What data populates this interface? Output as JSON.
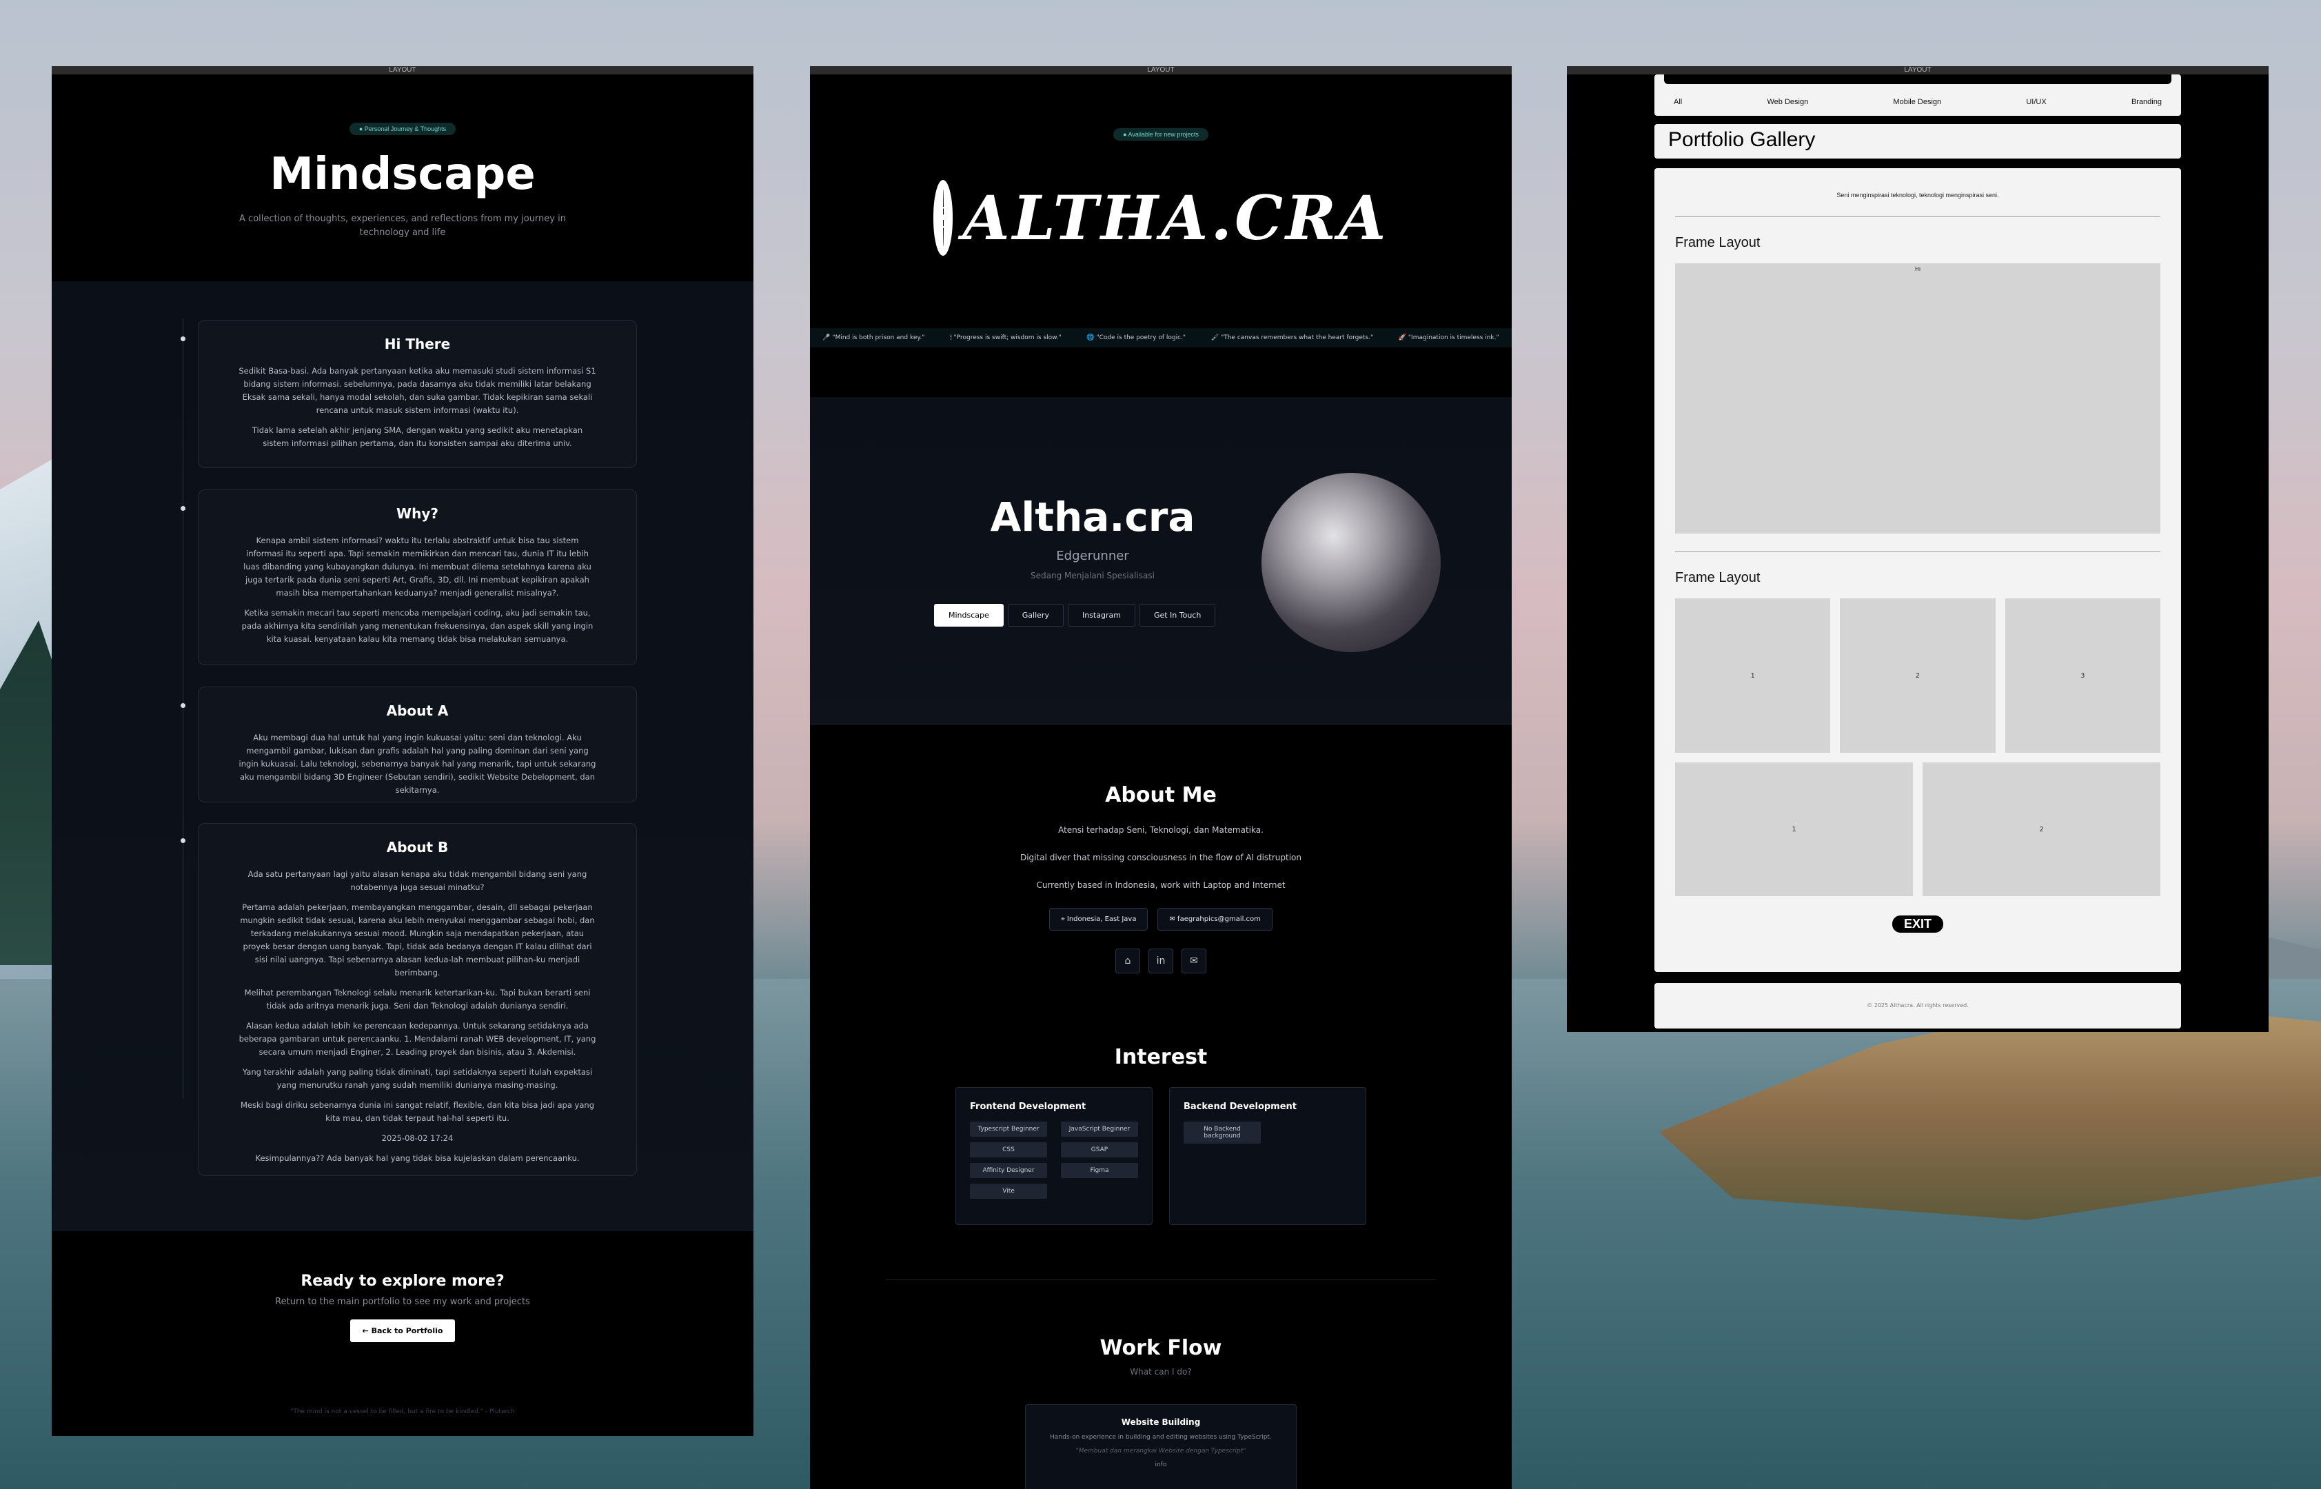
{
  "windows": {
    "titlebar": "LAYOUT"
  },
  "mindscape": {
    "badge": "● Personal Journey & Thoughts",
    "title": "Mindscape",
    "subtitle": "A collection of thoughts, experiences, and reflections from my journey in technology and life",
    "cards": [
      {
        "title": "Hi There",
        "paragraphs": [
          "Sedikit Basa-basi. Ada banyak pertanyaan ketika aku memasuki studi sistem informasi S1 bidang sistem informasi. sebelumnya, pada dasarnya aku tidak memiliki latar belakang Eksak sama sekali, hanya modal sekolah, dan suka gambar. Tidak kepikiran sama sekali rencana untuk masuk sistem informasi (waktu itu).",
          "Tidak lama setelah akhir jenjang SMA, dengan waktu yang sedikit aku menetapkan sistem informasi pilihan pertama, dan itu konsisten sampai aku diterima univ."
        ]
      },
      {
        "title": "Why?",
        "paragraphs": [
          "Kenapa ambil sistem informasi? waktu itu terlalu abstraktif untuk bisa tau sistem informasi itu seperti apa. Tapi semakin memikirkan dan mencari tau, dunia IT itu lebih luas dibanding yang kubayangkan dulunya. Ini membuat dilema setelahnya karena aku juga tertarik pada dunia seni seperti Art, Grafis, 3D, dll. Ini membuat kepikiran apakah masih bisa mempertahankan keduanya? menjadi generalist misalnya?.",
          "Ketika semakin mecari tau seperti mencoba mempelajari coding, aku jadi semakin tau, pada akhirnya kita sendirilah yang menentukan frekuensinya, dan aspek skill yang ingin kita kuasai. kenyataan kalau kita memang tidak bisa melakukan semuanya."
        ]
      },
      {
        "title": "About A",
        "paragraphs": [
          "Aku membagi dua hal untuk hal yang ingin kukuasai yaitu: seni dan teknologi. Aku mengambil gambar, lukisan dan grafis adalah hal yang paling dominan dari seni yang ingin kukuasai. Lalu teknologi, sebenarnya banyak hal yang menarik, tapi untuk sekarang aku mengambil bidang 3D Engineer (Sebutan sendiri), sedikit Website Debelopment, dan sekitarnya."
        ]
      },
      {
        "title": "About B",
        "paragraphs": [
          "Ada satu pertanyaan lagi yaitu alasan kenapa aku tidak mengambil bidang seni yang notabennya juga sesuai minatku?",
          "Pertama adalah pekerjaan, membayangkan menggambar, desain, dll sebagai pekerjaan mungkin sedikit tidak sesuai, karena aku lebih menyukai menggambar sebagai hobi, dan terkadang melakukannya sesuai mood. Mungkin saja mendapatkan pekerjaan, atau proyek besar dengan uang banyak. Tapi, tidak ada bedanya dengan IT kalau dilihat dari sisi nilai uangnya. Tapi sebenarnya alasan kedua-lah membuat pilihan-ku menjadi berimbang.",
          "Melihat perembangan Teknologi selalu menarik ketertarikan-ku. Tapi bukan berarti seni tidak ada aritnya menarik juga. Seni dan Teknologi adalah dunianya sendiri.",
          "Alasan kedua adalah lebih ke perencaan kedepannya. Untuk sekarang setidaknya ada beberapa gambaran untuk perencaanku. 1. Mendalami ranah WEB development, IT, yang secara umum menjadi Enginer, 2. Leading proyek dan bisinis, atau 3. Akdemisi.",
          "Yang terakhir adalah yang paling tidak diminati, tapi setidaknya seperti itulah expektasi yang menurutku ranah yang sudah memiliki dunianya masing-masing.",
          "Meski bagi diriku sebenarnya dunia ini sangat relatif, flexible, dan kita bisa jadi apa yang kita mau, dan tidak terpaut hal-hal seperti itu.",
          "2025-08-02 17:24",
          "Kesimpulannya?? Ada banyak hal yang tidak bisa kujelaskan dalam perencaanku."
        ]
      }
    ],
    "cta_title": "Ready to explore more?",
    "cta_sub": "Return to the main portfolio to see my work and projects",
    "cta_button": "← Back to Portfolio",
    "footer_quote": "\"The mind is not a vessel to be filled, but a fire to be kindled.\" - Plutarch"
  },
  "portfolio": {
    "badge": "● Available for new projects",
    "logo_text": "ALTHA.CRA",
    "logo_seal": "S",
    "ticker": [
      "🎤 \"Mind is both prison and key.\"",
      "🕯 \"Progress is swift; wisdom is slow.\"",
      "🌐 \"Code is the poetry of logic.\"",
      "🖌 \"The canvas remembers what the heart forgets.\"",
      "🚀 \"Imagination is timeless ink.\""
    ],
    "name": "Altha.cra",
    "role": "Edgerunner",
    "specialty": "Sedang Menjalani Spesialisasi",
    "nav": [
      "Mindscape",
      "Gallery",
      "Instagram",
      "Get In Touch"
    ],
    "about_title": "About Me",
    "about_lines": [
      "Atensi terhadap Seni, Teknologi, dan Matematika.",
      "Digital diver that missing consciousness in the flow of AI distruption",
      "Currently based in Indonesia, work with Laptop and Internet"
    ],
    "location": "Indonesia, East Java",
    "email": "faegrahpics@gmail.com",
    "socials": [
      "github-icon",
      "linkedin-icon",
      "mail-icon"
    ],
    "interest_title": "Interest",
    "frontend_title": "Frontend Development",
    "frontend_tags": [
      "Typescript Beginner",
      "JavaScript Beginner",
      "CSS",
      "GSAP",
      "Affinity Designer",
      "Figma",
      "Vite"
    ],
    "backend_title": "Backend Development",
    "backend_tags": [
      "No Backend background"
    ],
    "workflow_title": "Work Flow",
    "workflow_sub": "What can I do?",
    "workflow_card_title": "Website Building",
    "workflow_card_desc": "Hands-on experience in building and editing websites using TypeScript.",
    "workflow_card_italic": "\"Membuat dan merangkai Website dengan Typescript\"",
    "workflow_card_info": "info"
  },
  "gallery": {
    "filters": [
      "All",
      "Web Design",
      "Mobile Design",
      "UI/UX",
      "Branding"
    ],
    "title": "Portfolio Gallery",
    "subtitle": "Seni menginspirasi teknologi, teknologi menginspirasi seni.",
    "frame1_title": "Frame Layout",
    "frame1_label": "Hi",
    "frame2_title": "Frame Layout",
    "grid_row1": [
      "1",
      "2",
      "3"
    ],
    "grid_row2": [
      "1",
      "2"
    ],
    "exit_label": "EXIT",
    "footer": "© 2025 Althacra. All rights reserved."
  }
}
